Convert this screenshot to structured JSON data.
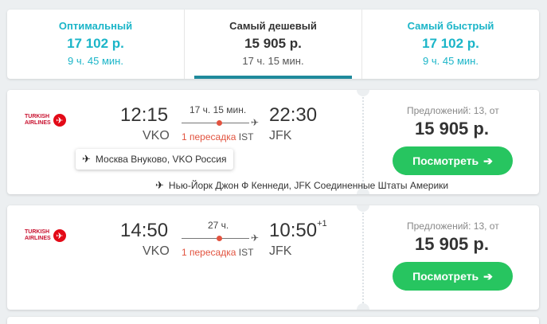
{
  "sort_tabs": [
    {
      "title": "Оптимальный",
      "price": "17 102 р.",
      "duration": "9 ч. 45 мин."
    },
    {
      "title": "Самый дешевый",
      "price": "15 905 р.",
      "duration": "17 ч. 15 мин."
    },
    {
      "title": "Самый быстрый",
      "price": "17 102 р.",
      "duration": "9 ч. 45 мин."
    }
  ],
  "active_tab": "Самый дешевый",
  "tickets": [
    {
      "airline": {
        "line1": "TURKISH",
        "line2": "AIRLINES"
      },
      "depart_time": "12:15",
      "depart_code": "VKO",
      "duration": "17 ч. 15 мин.",
      "stops": "1 пересадка",
      "stop_hub": "IST",
      "arrive_time": "22:30",
      "arrive_day": "",
      "arrive_code": "JFK",
      "offers": "Предложений: 13, от",
      "price": "15 905 р.",
      "button": "Посмотреть",
      "depart_tooltip": "Москва Внуково, VKO Россия",
      "arrive_tooltip": "Нью-Йорк Джон Ф Кеннеди, JFK Соединенные Штаты Америки"
    },
    {
      "airline": {
        "line1": "TURKISH",
        "line2": "AIRLINES"
      },
      "depart_time": "14:50",
      "depart_code": "VKO",
      "duration": "27 ч.",
      "stops": "1 пересадка",
      "stop_hub": "IST",
      "arrive_time": "10:50",
      "arrive_day": "+1",
      "arrive_code": "JFK",
      "offers": "Предложений: 13, от",
      "price": "15 905 р.",
      "button": "Посмотреть"
    }
  ],
  "colors": {
    "accent": "#1bb5c8",
    "active_underline": "#1f8a9c",
    "button": "#27c560",
    "stop": "#e2533f"
  },
  "icons": {
    "plane": "airplane-icon",
    "arrow": "arrow-right-icon",
    "airline_logo": "turkish-airlines-logo"
  }
}
